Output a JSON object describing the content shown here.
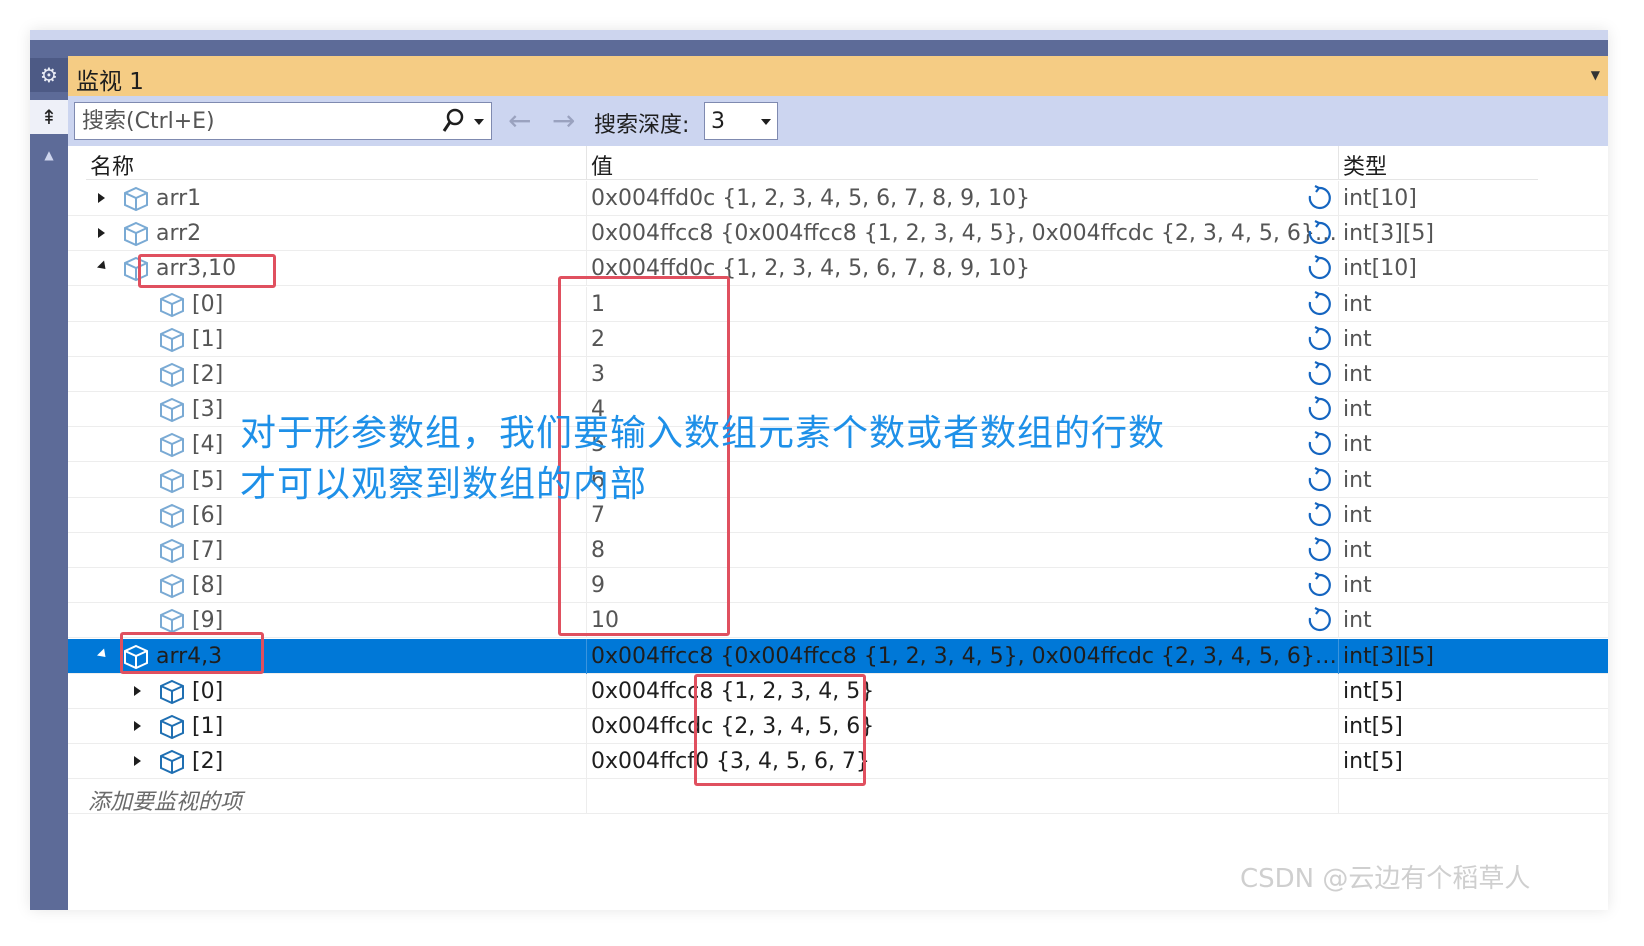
{
  "window": {
    "title": "监视 1"
  },
  "toolbar": {
    "search_placeholder": "搜索(Ctrl+E)",
    "depth_label": "搜索深度:",
    "depth_value": "3"
  },
  "columns": {
    "name": "名称",
    "value": "值",
    "type": "类型"
  },
  "rows": [
    {
      "name": "arr1",
      "value": "0x004ffd0c {1, 2, 3, 4, 5, 6, 7, 8, 9, 10}",
      "type": "int[10]",
      "expand": "collapsed",
      "level": 0
    },
    {
      "name": "arr2",
      "value": "0x004ffcc8 {0x004ffcc8 {1, 2, 3, 4, 5}, 0x004ffcdc {2, 3, 4, 5, 6}, 0x...",
      "type": "int[3][5]",
      "expand": "collapsed",
      "level": 0
    },
    {
      "name": "arr3,10",
      "value": "0x004ffd0c {1, 2, 3, 4, 5, 6, 7, 8, 9, 10}",
      "type": "int[10]",
      "expand": "expanded",
      "level": 0
    },
    {
      "name": "[0]",
      "value": "1",
      "type": "int",
      "expand": "none",
      "level": 1
    },
    {
      "name": "[1]",
      "value": "2",
      "type": "int",
      "expand": "none",
      "level": 1
    },
    {
      "name": "[2]",
      "value": "3",
      "type": "int",
      "expand": "none",
      "level": 1
    },
    {
      "name": "[3]",
      "value": "4",
      "type": "int",
      "expand": "none",
      "level": 1
    },
    {
      "name": "[4]",
      "value": "5",
      "type": "int",
      "expand": "none",
      "level": 1
    },
    {
      "name": "[5]",
      "value": "6",
      "type": "int",
      "expand": "none",
      "level": 1
    },
    {
      "name": "[6]",
      "value": "7",
      "type": "int",
      "expand": "none",
      "level": 1
    },
    {
      "name": "[7]",
      "value": "8",
      "type": "int",
      "expand": "none",
      "level": 1
    },
    {
      "name": "[8]",
      "value": "9",
      "type": "int",
      "expand": "none",
      "level": 1
    },
    {
      "name": "[9]",
      "value": "10",
      "type": "int",
      "expand": "none",
      "level": 1
    },
    {
      "name": "arr4,3",
      "value": "0x004ffcc8 {0x004ffcc8 {1, 2, 3, 4, 5}, 0x004ffcdc {2, 3, 4, 5, 6}, 0x004...",
      "type": "int[3][5]",
      "expand": "expanded",
      "level": 0,
      "selected": true
    },
    {
      "name": "[0]",
      "value": "0x004ffcc8 {1, 2, 3, 4, 5}",
      "type": "int[5]",
      "expand": "collapsed",
      "level": 1
    },
    {
      "name": "[1]",
      "value": "0x004ffcdc {2, 3, 4, 5, 6}",
      "type": "int[5]",
      "expand": "collapsed",
      "level": 1
    },
    {
      "name": "[2]",
      "value": "0x004ffcf0 {3, 4, 5, 6, 7}",
      "type": "int[5]",
      "expand": "collapsed",
      "level": 1
    }
  ],
  "add_item_placeholder": "添加要监视的项",
  "annotation": {
    "line1": "对于形参数组，我们要输入数组元素个数或者数组的行数",
    "line2": "才可以观察到数组的内部"
  },
  "watermark": "CSDN @云边有个稻草人",
  "colors": {
    "title_bar": "#f5cc84",
    "toolbar": "#ccd5f0",
    "selection": "#0078d7",
    "annotation_text": "#1e90e8",
    "highlight_box": "#e0505f",
    "frame": "#5d6b98"
  }
}
